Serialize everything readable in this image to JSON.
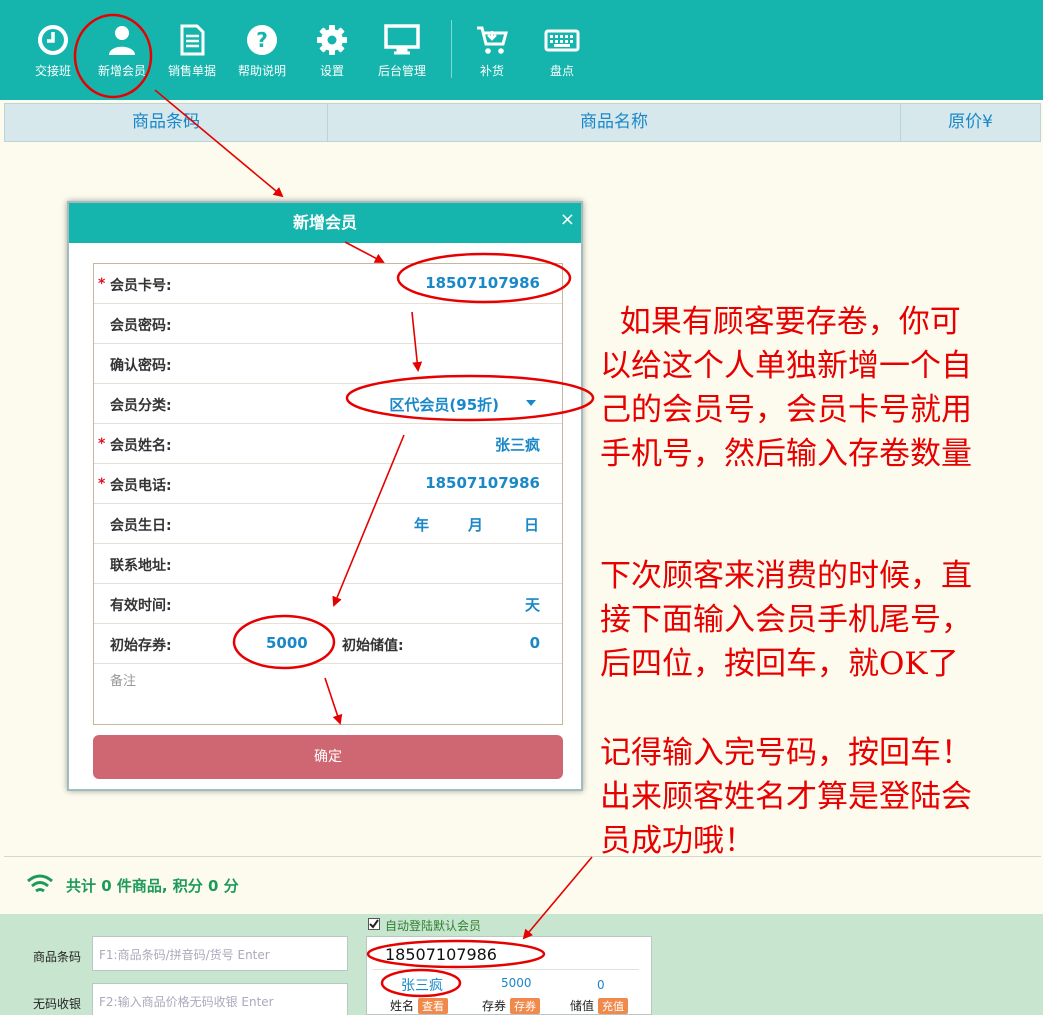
{
  "toolbar": {
    "items": [
      {
        "label": "交接班",
        "icon": "clock-icon"
      },
      {
        "label": "新增会员",
        "icon": "user-icon"
      },
      {
        "label": "销售单据",
        "icon": "document-icon"
      },
      {
        "label": "帮助说明",
        "icon": "help-icon"
      },
      {
        "label": "设置",
        "icon": "gear-icon"
      },
      {
        "label": "后台管理",
        "icon": "monitor-icon"
      },
      {
        "label": "补货",
        "icon": "cart-icon"
      },
      {
        "label": "盘点",
        "icon": "keyboard-icon"
      }
    ]
  },
  "table": {
    "columns": [
      "商品条码",
      "商品名称",
      "原价¥"
    ]
  },
  "modal": {
    "title": "新增会员",
    "close": "×",
    "fields": {
      "card_no": {
        "label": "会员卡号:",
        "value": "18507107986"
      },
      "password": {
        "label": "会员密码:"
      },
      "confirm_password": {
        "label": "确认密码:"
      },
      "category": {
        "label": "会员分类:",
        "value": "区代会员(95折)"
      },
      "name": {
        "label": "会员姓名:",
        "value": "张三疯"
      },
      "phone": {
        "label": "会员电话:",
        "value": "18507107986"
      },
      "birthday": {
        "label": "会员生日:",
        "year": "年",
        "month": "月",
        "day": "日"
      },
      "address": {
        "label": "联系地址:"
      },
      "valid": {
        "label": "有效时间:",
        "unit": "天"
      },
      "init_coupon": {
        "label": "初始存券:",
        "value": "5000"
      },
      "init_stored": {
        "label": "初始储值:",
        "value": "0"
      }
    },
    "remark_placeholder": "备注",
    "confirm_button": "确定",
    "required_mark": "*"
  },
  "summary": {
    "text": "共计 0 件商品, 积分 0 分"
  },
  "bottom": {
    "auto_login_label": "自动登陆默认会员",
    "barcode_label": "商品条码",
    "barcode_placeholder": "F1:商品条码/拼音码/货号 Enter",
    "nocode_label": "无码收银",
    "nocode_placeholder": "F2:输入商品价格无码收银 Enter",
    "member_input": "18507107986",
    "member_name": "张三疯",
    "member_coupon": "5000",
    "member_stored": "0",
    "name_label": "姓名",
    "view_tag": "查看",
    "coupon_label": "存券",
    "coupon_tag": "存券",
    "stored_label": "储值",
    "recharge_tag": "充值"
  },
  "annotations": {
    "block1": "  如果有顾客要存卷，你可\n以给这个人单独新增一个自\n己的会员号，会员卡号就用\n手机号，然后输入存卷数量",
    "block2": "下次顾客来消费的时候，直\n接下面输入会员手机尾号，\n后四位，按回车，就OK了",
    "block3": "记得输入完号码，按回车！\n出来顾客姓名才算是登陆会\n员成功哦！"
  },
  "colors": {
    "toolbar": "#15b5ad",
    "accent_blue": "#1a88c8",
    "annotation_red": "#e60000",
    "confirm_button": "#cf6772",
    "summary_green": "#1d9a5a"
  }
}
